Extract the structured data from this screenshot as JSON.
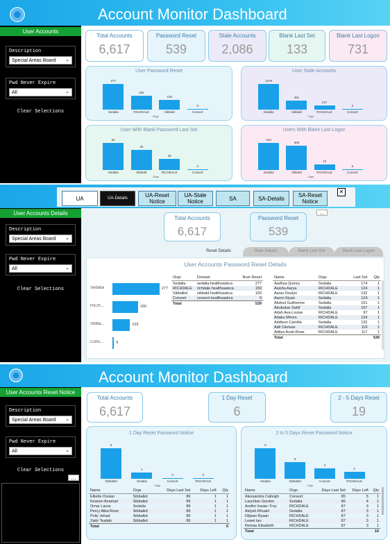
{
  "section1": {
    "title": "Account Monitor Dashboard",
    "sidebar": {
      "header": "User Accounts",
      "description_label": "Description",
      "description_value": "Special Areas Board",
      "pwd_label": "Pwd Never Expire",
      "pwd_value": "All",
      "clear": "Clear Selections"
    },
    "cards": [
      {
        "title": "Total Accounts",
        "value": "6,617",
        "color": "#ffffff"
      },
      {
        "title": "Password Reset",
        "value": "539",
        "color": "#e6f4fb"
      },
      {
        "title": "Stale Accounts",
        "value": "2,086",
        "color": "#eceaf8"
      },
      {
        "title": "Blank Last Set",
        "value": "133",
        "color": "#e6f6f1"
      },
      {
        "title": "Blank Last Logon",
        "value": "731",
        "color": "#fbeaf4"
      }
    ],
    "charts": [
      {
        "title": "User Password Reset",
        "bg": "#e6f4fb",
        "axis": "Orgs",
        "categories": [
          "Sedalia",
          "RICHDALE",
          "Sibbald",
          "Consort"
        ],
        "values": [
          277,
          150,
          103,
          9
        ]
      },
      {
        "title": "User Stale Accounts",
        "bg": "#eceaf8",
        "axis": "Orgs",
        "categories": [
          "Sedalia",
          "Sibbald",
          "RICHDALE",
          "Consort"
        ],
        "values": [
          1376,
          481,
          227,
          2
        ]
      },
      {
        "title": "User With Blank Password Last Set",
        "bg": "#e6f6f1",
        "axis": "Orgs",
        "categories": [
          "Sedalia",
          "Sibbald",
          "RICHDALE",
          "Consort"
        ],
        "values": [
          61,
          45,
          25,
          2
        ]
      },
      {
        "title": "Users With Blank Last Logon",
        "bg": "#fbeaf4",
        "axis": "Orgs",
        "categories": [
          "Sedalia",
          "Sibbald",
          "RICHDALE",
          "Consort"
        ],
        "values": [
          343,
          309,
          72,
          6
        ]
      }
    ]
  },
  "section2": {
    "tabs": [
      "UA",
      "UA-Details",
      "UA-Reset Notice",
      "UA-Stale Notice",
      "SA",
      "SA-Details",
      "SA-Reset Notice"
    ],
    "active_tab": 1,
    "close": "✕",
    "more": "…",
    "sidebar": {
      "header": "User Accounts Details",
      "description_label": "Description",
      "description_value": "Special Areas Board",
      "pwd_label": "Pwd Never Expire",
      "pwd_value": "All",
      "clear": "Clear Selections"
    },
    "cards": [
      {
        "title": "Total Accounts",
        "value": "6,617"
      },
      {
        "title": "Password Reset",
        "value": "539"
      }
    ],
    "subtabs": [
      "Reset Details",
      "Stale Details",
      "Blank Last Set",
      "Blank Last Logon"
    ],
    "details_title": "User Accounts Password Reset Details",
    "hbar": {
      "categories": [
        "Sedalia",
        "RICH...",
        "Sibba...",
        "Cons..."
      ],
      "values": [
        277,
        150,
        103,
        9
      ]
    },
    "orgs_table": {
      "headers": [
        "Orgs",
        "Domain",
        "Num Reset"
      ],
      "rows": [
        [
          "Sedalia",
          "sedalia.healthsaskca",
          "277"
        ],
        [
          "RICHDALE",
          "richdale.healthsaskca",
          "150"
        ],
        [
          "Sibbalkd",
          "sibbald.healthsaskca",
          "103"
        ],
        [
          "Consort",
          "consort.healthsaskca",
          "9"
        ]
      ],
      "total_label": "Total",
      "total": "539"
    },
    "names_table": {
      "headers": [
        "Name",
        "Orgs",
        "Last Set",
        "Qty"
      ],
      "rows": [
        [
          "Aadhya Quincy",
          "Sedalia",
          "174",
          "1"
        ],
        [
          "Aaisha Aarya",
          "RICHDALE",
          "124",
          "1"
        ],
        [
          "Aarav Doulyn",
          "RICHDALE",
          "132",
          "1"
        ],
        [
          "Aaron Kiyan",
          "Sedalia",
          "124",
          "1"
        ],
        [
          "Abdoul Guilherme",
          "Sedalia",
          "101",
          "1"
        ],
        [
          "Abubokar Sahil",
          "Sedalia",
          "167",
          "1"
        ],
        [
          "Adah Ava-Louise",
          "RICHDALE",
          "97",
          "1"
        ],
        [
          "Adaku Mirren",
          "RICHDALE",
          "134",
          "1"
        ],
        [
          "Addison Camilla",
          "Sedalia",
          "132",
          "1"
        ],
        [
          "Adil Clerisse",
          "RICHDALE",
          "119",
          "1"
        ],
        [
          "Aditya Avah-Rose",
          "RICHDALE",
          "117",
          "1"
        ]
      ],
      "total_label": "Total",
      "total": "539"
    }
  },
  "section3": {
    "title": "Account Monitor Dashboard",
    "sidebar": {
      "header": "User Accounts Reset Notice",
      "description_label": "Description",
      "description_value": "Special Areas Board",
      "pwd_label": "Pwd Never Expire",
      "pwd_value": "All",
      "clear": "Clear Selections",
      "more": "…"
    },
    "cards": [
      {
        "title": "Total Accounts",
        "value": "6,617"
      },
      {
        "title": "1 Day Reset",
        "value": "6"
      },
      {
        "title": "2 - 5 Days Reset",
        "value": "19"
      }
    ],
    "left_panel": {
      "title": "1 Day Reset Password Notice",
      "axis": "Orgs",
      "categories": [
        "Sibbalkd",
        "Sedalia",
        "Consort",
        "RICHDALE"
      ],
      "values": [
        5,
        1,
        0,
        0
      ],
      "headers": [
        "Name",
        "Orgs",
        "Days Last Set",
        "Days Left",
        "Qty"
      ],
      "rows": [
        [
          "Elliette Ossian",
          "Sibbalkd",
          "89",
          "1",
          "1"
        ],
        [
          "Keaven Anamari",
          "Sibbalkd",
          "89",
          "1",
          "1"
        ],
        [
          "Omar Laura",
          "Sedalia",
          "89",
          "1",
          "1"
        ],
        [
          "Percy Alba-Rose",
          "Sibbalkd",
          "89",
          "1",
          "1"
        ],
        [
          "Polly Jehad",
          "Sibbalkd",
          "89",
          "1",
          "1"
        ],
        [
          "Zakir Tealiah",
          "Sibbalkd",
          "89",
          "1",
          "1"
        ]
      ],
      "total_label": "Total",
      "total": "6"
    },
    "right_panel": {
      "title": "2 to 5 Days Reset Password Notice",
      "axis": "Orgs",
      "categories": [
        "Sedalia",
        "Sibbalkd",
        "Consort",
        "RICHDALE"
      ],
      "values": [
        9,
        5,
        3,
        2
      ],
      "headers": [
        "Name",
        "Orgs",
        "Days Last Set",
        "Days Left",
        "Qty"
      ],
      "rows": [
        [
          "Alessandra Calleigh",
          "Consort",
          "85",
          "5",
          "1"
        ],
        [
          "Lauchlan Gordon",
          "Sedalia",
          "86",
          "4",
          "1"
        ],
        [
          "Aodhri Xavier-Troy",
          "RICHDALE",
          "87",
          "3",
          "1"
        ],
        [
          "Asiyah Rhuairi",
          "Sedalia",
          "87",
          "3",
          "1"
        ],
        [
          "Diljaan Ryaan",
          "RICHDALE",
          "87",
          "3",
          "1"
        ],
        [
          "Lewei Ian",
          "RICHDALE",
          "87",
          "3",
          "1"
        ],
        [
          "Remas Elisabeth",
          "RICHDALE",
          "87",
          "3",
          "1"
        ]
      ],
      "total_label": "Total",
      "total": "19"
    }
  }
}
